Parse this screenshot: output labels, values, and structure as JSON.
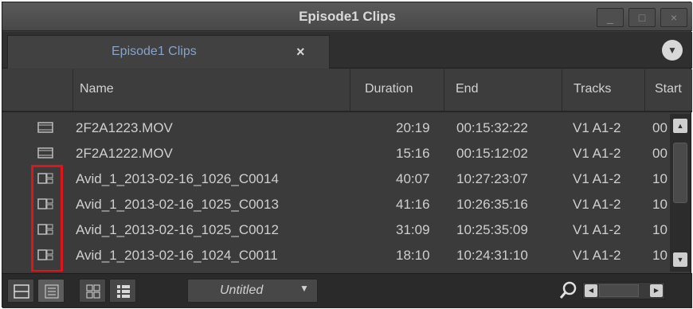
{
  "window": {
    "title": "Episode1 Clips"
  },
  "window_controls": {
    "minimize": "_",
    "maximize": "□",
    "close": "×"
  },
  "tab": {
    "label": "Episode1 Clips",
    "close": "×"
  },
  "tab_menu_icon": "chevron-down-icon",
  "columns": [
    "Name",
    "Duration",
    "End",
    "Tracks",
    "Start"
  ],
  "rows": [
    {
      "icon": "masterclip-icon",
      "name": "2F2A1223.MOV",
      "duration": "20:19",
      "end": "00:15:32:22",
      "tracks": "V1 A1-2",
      "start": "00"
    },
    {
      "icon": "masterclip-icon",
      "name": "2F2A1222.MOV",
      "duration": "15:16",
      "end": "00:15:12:02",
      "tracks": "V1 A1-2",
      "start": "00"
    },
    {
      "icon": "subclip-icon",
      "name": "Avid_1_2013-02-16_1026_C0014",
      "duration": "40:07",
      "end": "10:27:23:07",
      "tracks": "V1 A1-2",
      "start": "10"
    },
    {
      "icon": "subclip-icon",
      "name": "Avid_1_2013-02-16_1025_C0013",
      "duration": "41:16",
      "end": "10:26:35:16",
      "tracks": "V1 A1-2",
      "start": "10"
    },
    {
      "icon": "subclip-icon",
      "name": "Avid_1_2013-02-16_1025_C0012",
      "duration": "31:09",
      "end": "10:25:35:09",
      "tracks": "V1 A1-2",
      "start": "10"
    },
    {
      "icon": "subclip-icon",
      "name": "Avid_1_2013-02-16_1024_C0011",
      "duration": "18:10",
      "end": "10:24:31:10",
      "tracks": "V1 A1-2",
      "start": "10"
    }
  ],
  "bottom_bar": {
    "view_buttons": [
      "frame-view-icon",
      "text-view-icon",
      "script-view-icon",
      "list-view-icon"
    ],
    "bin_view": "Untitled",
    "find_icon": "search-icon"
  },
  "colors": {
    "highlight": "#e0141b",
    "tab_text": "#86a3c9"
  }
}
